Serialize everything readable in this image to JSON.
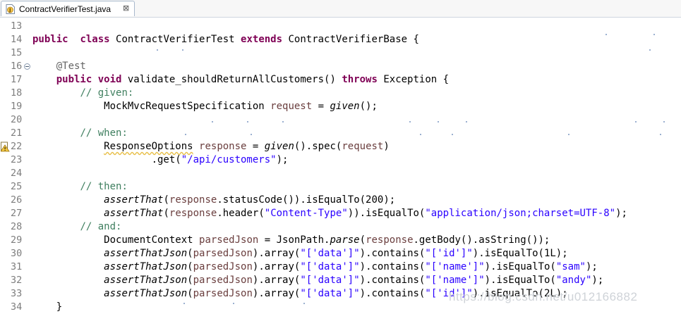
{
  "tab": {
    "title": "ContractVerifierTest.java",
    "close_glyph": "⊠",
    "icon": "java-file-icon"
  },
  "editor": {
    "lines": [
      {
        "num": "13",
        "segs": []
      },
      {
        "num": "14",
        "segs": [
          [
            "kw",
            "public"
          ],
          [
            "",
            "  "
          ],
          [
            "kw",
            "class"
          ],
          [
            "",
            " ContractVerifierTest "
          ],
          [
            "kw",
            "extends"
          ],
          [
            "",
            " ContractVerifierBase {"
          ]
        ]
      },
      {
        "num": "15",
        "segs": []
      },
      {
        "num": "16",
        "fold": true,
        "segs": [
          [
            "",
            "    "
          ],
          [
            "an",
            "@Test"
          ]
        ]
      },
      {
        "num": "17",
        "segs": [
          [
            "",
            "    "
          ],
          [
            "kw",
            "public"
          ],
          [
            "",
            " "
          ],
          [
            "kw",
            "void"
          ],
          [
            "",
            " validate_shouldReturnAllCustomers() "
          ],
          [
            "kw",
            "throws"
          ],
          [
            "",
            " Exception {"
          ]
        ]
      },
      {
        "num": "18",
        "segs": [
          [
            "",
            "        "
          ],
          [
            "cm",
            "// given:"
          ]
        ]
      },
      {
        "num": "19",
        "segs": [
          [
            "",
            "            MockMvcRequestSpecification "
          ],
          [
            "var",
            "request"
          ],
          [
            "",
            " = "
          ],
          [
            "it",
            "given"
          ],
          [
            "",
            "();"
          ]
        ]
      },
      {
        "num": "20",
        "segs": []
      },
      {
        "num": "21",
        "segs": [
          [
            "",
            "        "
          ],
          [
            "cm",
            "// when:"
          ]
        ]
      },
      {
        "num": "22",
        "warn": true,
        "segs": [
          [
            "",
            "            "
          ],
          [
            "warn",
            "ResponseOptions"
          ],
          [
            "",
            " "
          ],
          [
            "var",
            "response"
          ],
          [
            "",
            " = "
          ],
          [
            "it",
            "given"
          ],
          [
            "",
            "().spec("
          ],
          [
            "var",
            "request"
          ],
          [
            ")"
          ]
        ]
      },
      {
        "num": "23",
        "segs": [
          [
            "",
            "                    .get("
          ],
          [
            "st",
            "\"/api/customers\""
          ],
          [
            ");"
          ]
        ]
      },
      {
        "num": "24",
        "segs": []
      },
      {
        "num": "25",
        "segs": [
          [
            "",
            "        "
          ],
          [
            "cm",
            "// then:"
          ]
        ]
      },
      {
        "num": "26",
        "segs": [
          [
            "",
            "            "
          ],
          [
            "it",
            "assertThat"
          ],
          [
            "("
          ],
          [
            "var",
            "response"
          ],
          [
            ".statusCode()).isEqualTo(200);"
          ]
        ]
      },
      {
        "num": "27",
        "segs": [
          [
            "",
            "            "
          ],
          [
            "it",
            "assertThat"
          ],
          [
            "("
          ],
          [
            "var",
            "response"
          ],
          [
            ".header("
          ],
          [
            "st",
            "\"Content-Type\""
          ],
          [
            ")).isEqualTo("
          ],
          [
            "st",
            "\"application/json;charset=UTF-8\""
          ],
          [
            ");"
          ]
        ]
      },
      {
        "num": "28",
        "segs": [
          [
            "",
            "        "
          ],
          [
            "cm",
            "// and:"
          ]
        ]
      },
      {
        "num": "29",
        "segs": [
          [
            "",
            "            DocumentContext "
          ],
          [
            "var",
            "parsedJson"
          ],
          [
            "",
            " = JsonPath."
          ],
          [
            "it",
            "parse"
          ],
          [
            "("
          ],
          [
            "var",
            "response"
          ],
          [
            ".getBody().asString());"
          ]
        ]
      },
      {
        "num": "30",
        "segs": [
          [
            "",
            "            "
          ],
          [
            "it",
            "assertThatJson"
          ],
          [
            "("
          ],
          [
            "var",
            "parsedJson"
          ],
          [
            ").array("
          ],
          [
            "st",
            "\"['data']\""
          ],
          [
            ").contains("
          ],
          [
            "st",
            "\"['id']\""
          ],
          [
            ").isEqualTo(1L);"
          ]
        ]
      },
      {
        "num": "31",
        "segs": [
          [
            "",
            "            "
          ],
          [
            "it",
            "assertThatJson"
          ],
          [
            "("
          ],
          [
            "var",
            "parsedJson"
          ],
          [
            ").array("
          ],
          [
            "st",
            "\"['data']\""
          ],
          [
            ").contains("
          ],
          [
            "st",
            "\"['name']\""
          ],
          [
            ").isEqualTo("
          ],
          [
            "st",
            "\"sam\""
          ],
          [
            ");"
          ]
        ]
      },
      {
        "num": "32",
        "segs": [
          [
            "",
            "            "
          ],
          [
            "it",
            "assertThatJson"
          ],
          [
            "("
          ],
          [
            "var",
            "parsedJson"
          ],
          [
            ").array("
          ],
          [
            "st",
            "\"['data']\""
          ],
          [
            ").contains("
          ],
          [
            "st",
            "\"['name']\""
          ],
          [
            ").isEqualTo("
          ],
          [
            "st",
            "\"andy\""
          ],
          [
            ");"
          ]
        ]
      },
      {
        "num": "33",
        "segs": [
          [
            "",
            "            "
          ],
          [
            "it",
            "assertThatJson"
          ],
          [
            "("
          ],
          [
            "var",
            "parsedJson"
          ],
          [
            ").array("
          ],
          [
            "st",
            "\"['data']\""
          ],
          [
            ").contains("
          ],
          [
            "st",
            "\"['id']\""
          ],
          [
            ").isEqualTo(2L);"
          ]
        ]
      },
      {
        "num": "34",
        "segs": [
          [
            "",
            "    }"
          ]
        ]
      }
    ]
  },
  "watermark": "https://blog.csdn.net/u012166882",
  "colors": {
    "keyword": "#7f0055",
    "comment": "#3f7f5f",
    "string": "#2a00ff",
    "variable": "#6a3e3e",
    "annotation": "#646464",
    "line_number": "#7d7d7d"
  }
}
